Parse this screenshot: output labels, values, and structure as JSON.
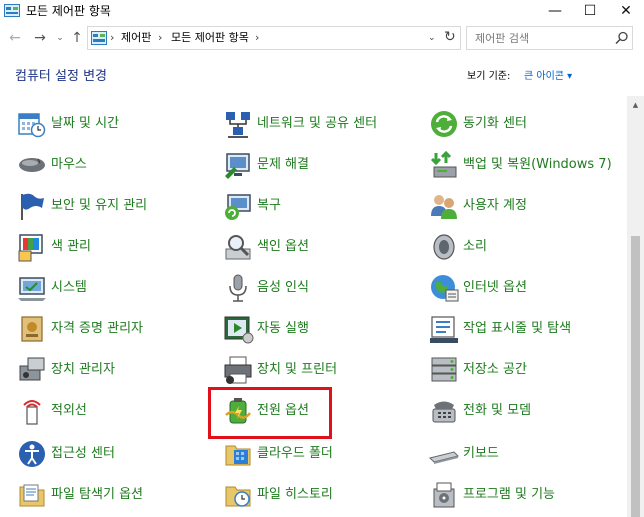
{
  "window": {
    "title": "모든 제어판 항목",
    "minimize_glyph": "—",
    "maximize_glyph": "☐",
    "close_glyph": "✕"
  },
  "nav": {
    "back_glyph": "←",
    "forward_glyph": "→",
    "recent_glyph": "⌄",
    "up_glyph": "↑"
  },
  "address": {
    "breadcrumbs": [
      "제어판",
      "모든 제어판 항목"
    ],
    "separator": "›",
    "dropdown_glyph": "⌄",
    "refresh_glyph": "↻"
  },
  "search": {
    "placeholder": "제어판 검색"
  },
  "header": {
    "title": "컴퓨터 설정 변경",
    "view_by_label": "보기 기준:",
    "view_by_value": "큰 아이콘 ▾"
  },
  "items": [
    {
      "label": "날짜 및 시간",
      "icon": "calendar-clock-icon"
    },
    {
      "label": "네트워크 및 공유 센터",
      "icon": "network-icon"
    },
    {
      "label": "동기화 센터",
      "icon": "sync-icon"
    },
    {
      "label": "마우스",
      "icon": "mouse-icon"
    },
    {
      "label": "문제 해결",
      "icon": "troubleshoot-icon"
    },
    {
      "label": "백업 및 복원(Windows 7)",
      "icon": "backup-icon"
    },
    {
      "label": "보안 및 유지 관리",
      "icon": "flag-icon"
    },
    {
      "label": "복구",
      "icon": "recovery-icon"
    },
    {
      "label": "사용자 계정",
      "icon": "users-icon"
    },
    {
      "label": "색 관리",
      "icon": "color-management-icon"
    },
    {
      "label": "색인 옵션",
      "icon": "indexing-icon"
    },
    {
      "label": "소리",
      "icon": "speaker-icon"
    },
    {
      "label": "시스템",
      "icon": "system-icon"
    },
    {
      "label": "음성 인식",
      "icon": "microphone-icon"
    },
    {
      "label": "인터넷 옵션",
      "icon": "internet-icon"
    },
    {
      "label": "자격 증명 관리자",
      "icon": "credential-icon"
    },
    {
      "label": "자동 실행",
      "icon": "autoplay-icon"
    },
    {
      "label": "작업 표시줄 및 탐색",
      "icon": "taskbar-icon"
    },
    {
      "label": "장치 관리자",
      "icon": "device-manager-icon"
    },
    {
      "label": "장치 및 프린터",
      "icon": "printer-icon"
    },
    {
      "label": "저장소 공간",
      "icon": "storage-icon"
    },
    {
      "label": "적외선",
      "icon": "infrared-icon"
    },
    {
      "label": "전원 옵션",
      "icon": "power-options-icon"
    },
    {
      "label": "전화 및 모뎀",
      "icon": "phone-icon"
    },
    {
      "label": "접근성 센터",
      "icon": "accessibility-icon"
    },
    {
      "label": "클라우드 폴더",
      "icon": "work-folders-icon"
    },
    {
      "label": "키보드",
      "icon": "keyboard-icon"
    },
    {
      "label": "파일 탐색기 옵션",
      "icon": "folder-options-icon"
    },
    {
      "label": "파일 히스토리",
      "icon": "file-history-icon"
    },
    {
      "label": "프로그램 및 기능",
      "icon": "programs-icon"
    }
  ],
  "scrollbar": {
    "up_glyph": "▲"
  },
  "colors": {
    "accent": "#1e3287",
    "link_green": "#1e7b1e",
    "highlight": "#e0111a",
    "view_link": "#0066cc"
  }
}
